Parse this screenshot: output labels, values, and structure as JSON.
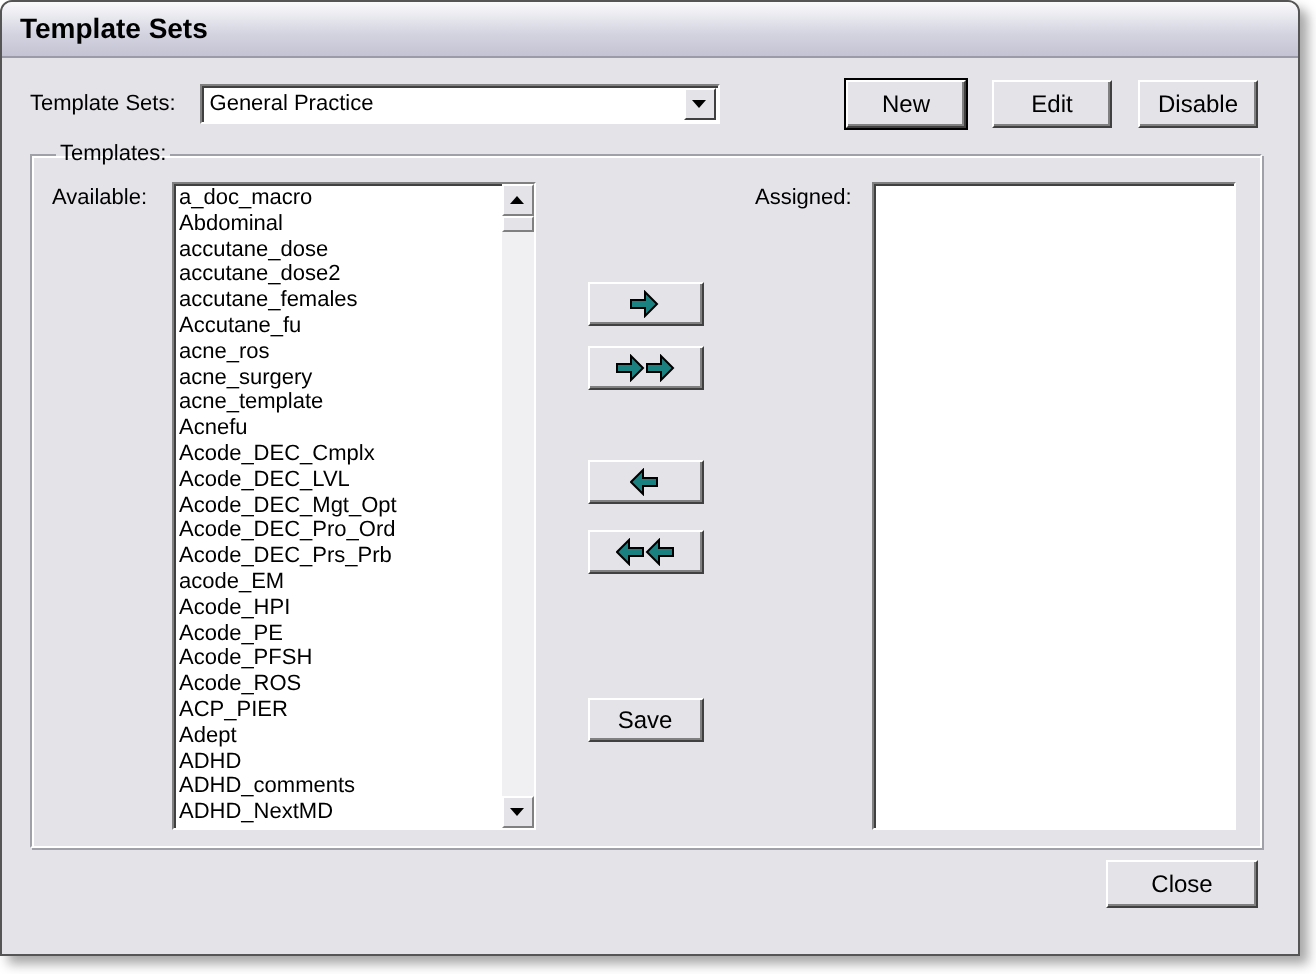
{
  "window": {
    "title": "Template Sets"
  },
  "template_set": {
    "label": "Template Sets:",
    "value": "General Practice"
  },
  "buttons": [
    {
      "label": "New",
      "default": true
    },
    {
      "label": "Edit",
      "default": false
    },
    {
      "label": "Disable",
      "default": false
    }
  ],
  "templates_group": {
    "label": "Templates:",
    "available": {
      "label": "Available:",
      "items": [
        "a_doc_macro",
        "Abdominal",
        "accutane_dose",
        "accutane_dose2",
        "accutane_females",
        "Accutane_fu",
        "acne_ros",
        "acne_surgery",
        "acne_template",
        "Acnefu",
        "Acode_DEC_Cmplx",
        "Acode_DEC_LVL",
        "Acode_DEC_Mgt_Opt",
        "Acode_DEC_Pro_Ord",
        "Acode_DEC_Prs_Prb",
        "acode_EM",
        "Acode_HPI",
        "Acode_PE",
        "Acode_PFSH",
        "Acode_ROS",
        "ACP_PIER",
        "Adept",
        "ADHD",
        "ADHD_comments",
        "ADHD_NextMD"
      ]
    },
    "transfer_buttons": [
      {
        "kind": "add"
      },
      {
        "kind": "add-all"
      },
      {
        "kind": "remove"
      },
      {
        "kind": "remove-all"
      }
    ],
    "save_button": "Save",
    "assigned": {
      "label": "Assigned:"
    }
  },
  "close_button": "Close"
}
